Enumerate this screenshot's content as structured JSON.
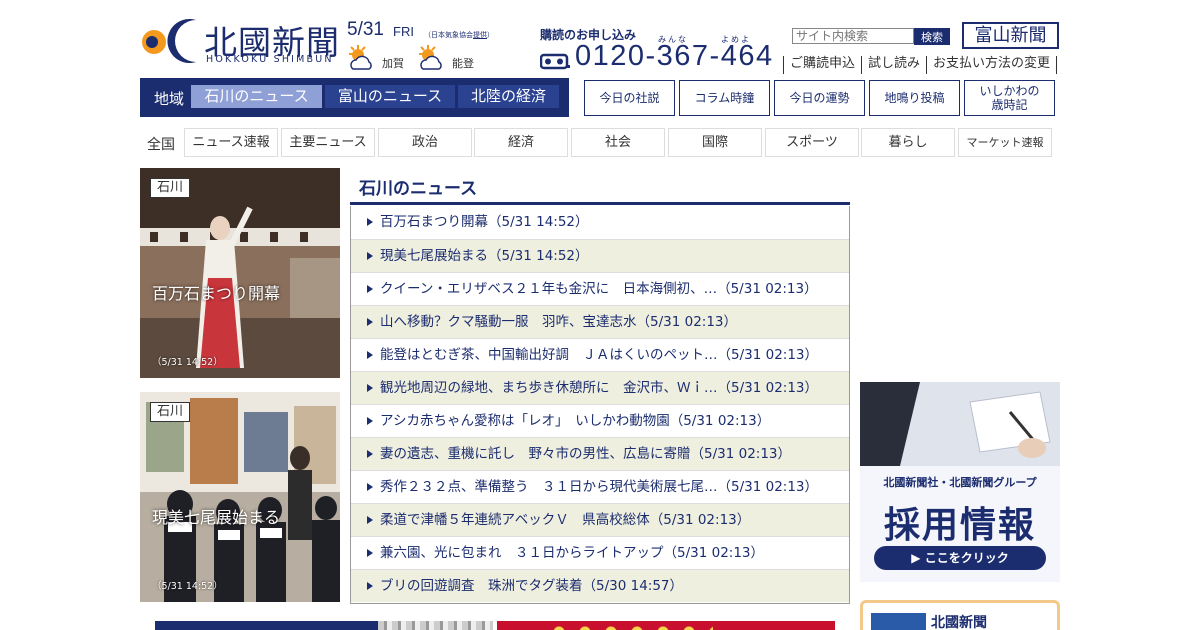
{
  "header": {
    "logo_text": "北國新聞",
    "logo_sub": "HOKKOKU SHIMBUN",
    "date": "5/31",
    "day": "FRI",
    "weather_note_prefix": "（日本気象協会",
    "weather_note_link": "提供",
    "weather_note_suffix": "）",
    "weather": [
      {
        "area": "加賀",
        "icon": "sun-cloud-icon"
      },
      {
        "area": "能登",
        "icon": "sun-cloud-icon"
      }
    ],
    "subscribe_title": "購読のお申し込み",
    "phone_ruby_1": "みんな",
    "phone_ruby_2": "よめよ",
    "phone": "0120-367-464",
    "search_placeholder": "サイト内検索",
    "search_button": "検索",
    "toyama_logo": "富山新聞",
    "util_links": [
      "ご購読申込",
      "試し読み",
      "お支払い方法の変更"
    ]
  },
  "region_nav": {
    "label": "地域",
    "tabs": [
      "石川のニュース",
      "富山のニュース",
      "北陸の経済"
    ],
    "active": 0
  },
  "feature_buttons": [
    "今日の社説",
    "コラム時鐘",
    "今日の運勢",
    "地鳴り投稿",
    "いしかわの\n歳時記"
  ],
  "category_nav": {
    "all": "全国",
    "items": [
      "ニュース速報",
      "主要ニュース",
      "政治",
      "経済",
      "社会",
      "国際",
      "スポーツ",
      "暮らし",
      "マーケット速報"
    ]
  },
  "photos": [
    {
      "tag": "石川",
      "caption": "百万石まつり開幕",
      "time": "（5/31 14:52）"
    },
    {
      "tag": "石川",
      "caption": "現美七尾展始まる",
      "time": "（5/31 14:52）"
    }
  ],
  "news": {
    "title": "石川のニュース",
    "items": [
      "百万石まつり開幕（5/31 14:52）",
      "現美七尾展始まる（5/31 14:52）",
      "クイーン・エリザベス２１年も金沢に　日本海側初、…（5/31 02:13）",
      "山へ移動？クマ騒動一服　羽咋、宝達志水（5/31 02:13）",
      "能登はとむぎ茶、中国輸出好調　ＪＡはくいのペット…（5/31 02:13）",
      "観光地周辺の緑地、まち歩き休憩所に　金沢市、Ｗｉ…（5/31 02:13）",
      "アシカ赤ちゃん愛称は「レオ」　いしかわ動物園（5/31 02:13）",
      "妻の遺志、重機に託し　野々市の男性、広島に寄贈（5/31 02:13）",
      "秀作２３２点、準備整う　３１日から現代美術展七尾…（5/31 02:13）",
      "柔道で津幡５年連続アベックＶ　県高校総体（5/31 02:13）",
      "兼六園、光に包まれ　３１日からライトアップ（5/31 02:13）",
      "ブリの回遊調査　珠洲でタグ装着（5/30 14:57）"
    ]
  },
  "recruit": {
    "line1": "北國新聞社・北國新聞グループ",
    "line2": "採用情報",
    "button": "▶ ここをクリック"
  },
  "promo_box": {
    "title": "北國新聞"
  },
  "colors": {
    "brand": "#1c2d6f",
    "active_tab": "#8ea0d6",
    "row_alt": "#efefdf",
    "logo_orange": "#f39a1e"
  }
}
